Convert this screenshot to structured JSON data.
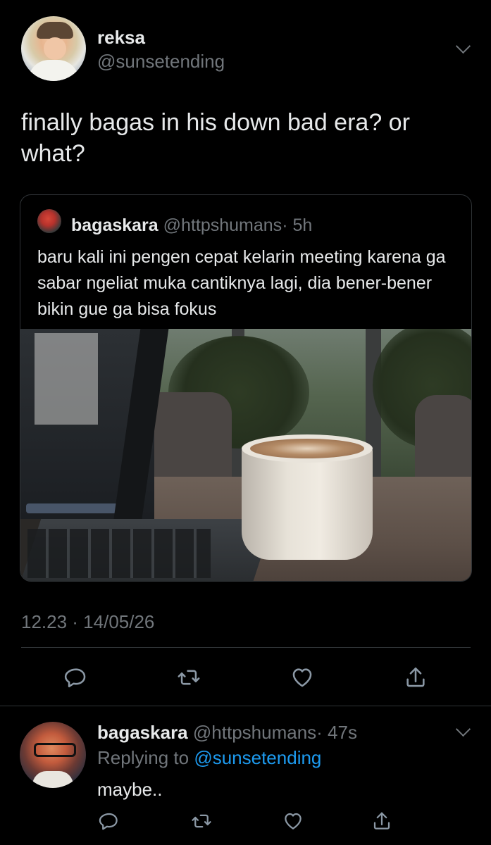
{
  "main_tweet": {
    "author_name": "reksa",
    "author_handle": "@sunsetending",
    "text": "finally bagas in his down bad era? or what?",
    "timestamp": "12.23 · 14/05/26"
  },
  "quoted_tweet": {
    "author_name": "bagaskara",
    "author_handle": "@httpshumans",
    "time": "· 5h",
    "text": "baru kali ini pengen cepat kelarin meeting karena ga sabar ngeliat muka cantiknya lagi, dia bener-bener bikin gue ga bisa fokus"
  },
  "reply": {
    "author_name": "bagaskara",
    "author_handle": "@httpshumans",
    "time": "· 47s",
    "replying_to_label": "Replying to",
    "replying_to_handle": "@sunsetending",
    "text": "maybe.."
  },
  "icons": {
    "reply": "reply-icon",
    "retweet": "retweet-icon",
    "like": "heart-icon",
    "share": "share-icon",
    "more": "chevron-down-icon"
  },
  "colors": {
    "background": "#000000",
    "text_primary": "#e7e9ea",
    "text_secondary": "#71767b",
    "link": "#1d9bf0",
    "border": "#2f3336"
  }
}
